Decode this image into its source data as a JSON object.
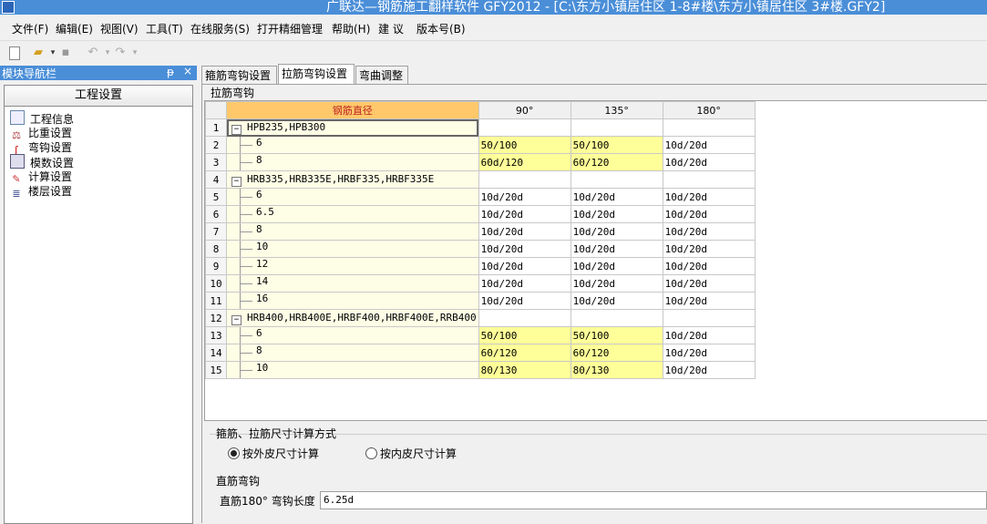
{
  "window": {
    "title": "广联达—钢筋施工翻样软件 GFY2012 - [C:\\东方小镇居住区 1-8#楼\\东方小镇居住区  3#楼.GFY2]"
  },
  "menu": [
    "文件(F)",
    "编辑(E)",
    "视图(V)",
    "工具(T)",
    "在线服务(S)",
    "打开精细管理",
    "帮助(H)",
    "建 议",
    "版本号(B)"
  ],
  "nav": {
    "header": "模块导航栏",
    "pin": "ᵽ",
    "close": "×",
    "section": "工程设置",
    "items": [
      "工程信息",
      "比重设置",
      "弯钩设置",
      "模数设置",
      "计算设置",
      "楼层设置"
    ]
  },
  "tabs": [
    "箍筋弯钩设置",
    "拉筋弯钩设置",
    "弯曲调整"
  ],
  "group_label": "拉筋弯钩",
  "grid": {
    "headers": [
      "钢筋直径",
      "90°",
      "135°",
      "180°"
    ],
    "rows": [
      {
        "n": "1",
        "name": "HPB235,HPB300",
        "group": true,
        "v": [
          "",
          "",
          ""
        ]
      },
      {
        "n": "2",
        "name": "6",
        "v": [
          "50/100",
          "50/100",
          "10d/20d"
        ],
        "y": [
          true,
          true,
          false
        ]
      },
      {
        "n": "3",
        "name": "8",
        "v": [
          "60d/120",
          "60/120",
          "10d/20d"
        ],
        "y": [
          true,
          true,
          false
        ]
      },
      {
        "n": "4",
        "name": "HRB335,HRB335E,HRBF335,HRBF335E",
        "group": true,
        "v": [
          "",
          "",
          ""
        ]
      },
      {
        "n": "5",
        "name": "6",
        "v": [
          "10d/20d",
          "10d/20d",
          "10d/20d"
        ]
      },
      {
        "n": "6",
        "name": "6.5",
        "v": [
          "10d/20d",
          "10d/20d",
          "10d/20d"
        ]
      },
      {
        "n": "7",
        "name": "8",
        "v": [
          "10d/20d",
          "10d/20d",
          "10d/20d"
        ]
      },
      {
        "n": "8",
        "name": "10",
        "v": [
          "10d/20d",
          "10d/20d",
          "10d/20d"
        ]
      },
      {
        "n": "9",
        "name": "12",
        "v": [
          "10d/20d",
          "10d/20d",
          "10d/20d"
        ]
      },
      {
        "n": "10",
        "name": "14",
        "v": [
          "10d/20d",
          "10d/20d",
          "10d/20d"
        ]
      },
      {
        "n": "11",
        "name": "16",
        "v": [
          "10d/20d",
          "10d/20d",
          "10d/20d"
        ]
      },
      {
        "n": "12",
        "name": "HRB400,HRB400E,HRBF400,HRBF400E,RRB400",
        "group": true,
        "v": [
          "",
          "",
          ""
        ]
      },
      {
        "n": "13",
        "name": "6",
        "v": [
          "50/100",
          "50/100",
          "10d/20d"
        ],
        "y": [
          true,
          true,
          false
        ]
      },
      {
        "n": "14",
        "name": "8",
        "v": [
          "60/120",
          "60/120",
          "10d/20d"
        ],
        "y": [
          true,
          true,
          false
        ]
      },
      {
        "n": "15",
        "name": "10",
        "v": [
          "80/130",
          "80/130",
          "10d/20d"
        ],
        "y": [
          true,
          true,
          false
        ]
      }
    ]
  },
  "calc_method": {
    "label": "箍筋、拉筋尺寸计算方式",
    "opt_outer": "按外皮尺寸计算",
    "opt_inner": "按内皮尺寸计算",
    "selected": "按外皮尺寸计算"
  },
  "straight_hook": {
    "label": "直筋弯钩",
    "field_label": "直筋180° 弯钩长度",
    "value": "6.25d"
  }
}
